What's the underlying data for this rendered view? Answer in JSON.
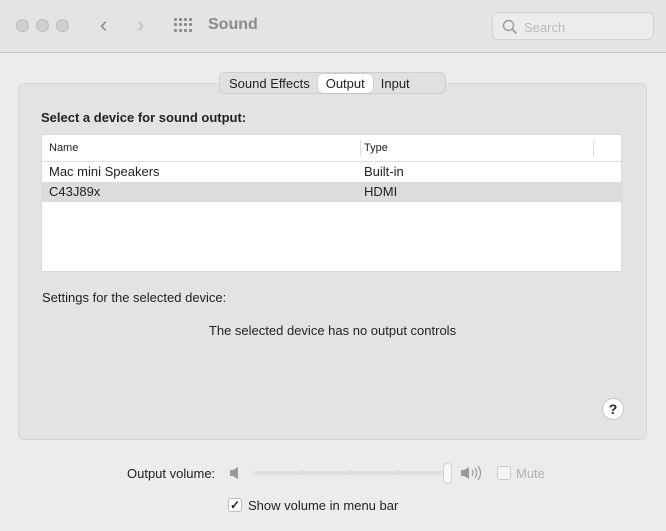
{
  "window": {
    "title": "Sound",
    "search_placeholder": "Search"
  },
  "tabs": [
    {
      "label": "Sound Effects",
      "selected": false
    },
    {
      "label": "Output",
      "selected": true
    },
    {
      "label": "Input",
      "selected": false
    }
  ],
  "output": {
    "heading": "Select a device for sound output:",
    "columns": [
      "Name",
      "Type"
    ],
    "devices": [
      {
        "name": "Mac mini Speakers",
        "type": "Built-in",
        "selected": false
      },
      {
        "name": "C43J89x",
        "type": "HDMI",
        "selected": true
      }
    ],
    "settings_label": "Settings for the selected device:",
    "no_controls": "The selected device has no output controls",
    "help": "?"
  },
  "volume": {
    "label": "Output volume:",
    "level_percent": 100,
    "mute_label": "Mute",
    "mute_checked": false
  },
  "menubar": {
    "label": "Show volume in menu bar",
    "checked": true,
    "check": "✓"
  }
}
